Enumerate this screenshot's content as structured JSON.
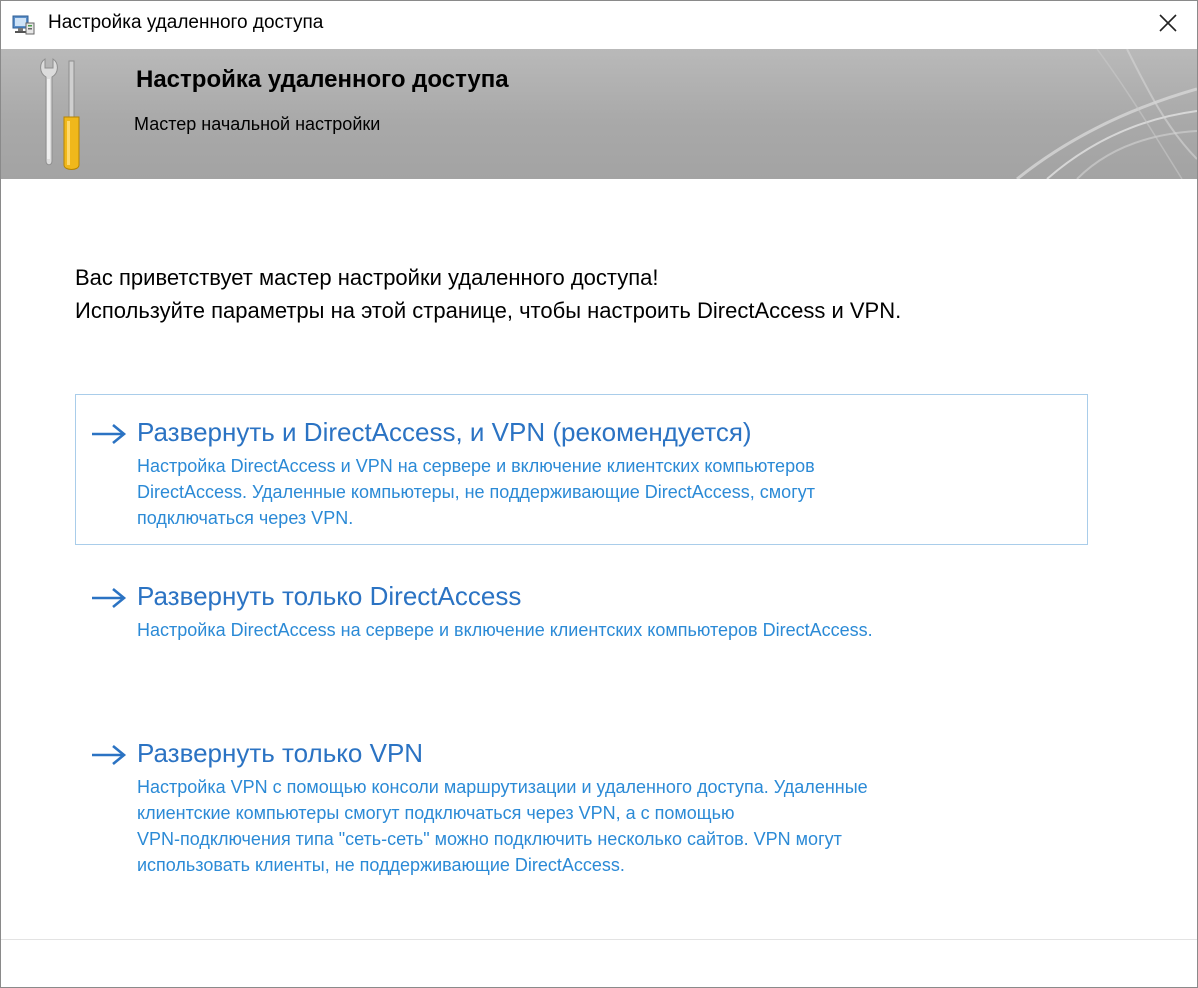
{
  "window": {
    "title": "Настройка удаленного доступа",
    "close_icon": "close-icon"
  },
  "banner": {
    "heading": "Настройка удаленного доступа",
    "subheading": "Мастер начальной настройки",
    "icon": "wrench-screwdriver-icon"
  },
  "intro": {
    "line1": "Вас приветствует мастер настройки удаленного доступа!",
    "line2": "Используйте параметры на этой странице, чтобы настроить DirectAccess и VPN."
  },
  "options": [
    {
      "label": "Развернуть и DirectAccess, и VPN (рекомендуется)",
      "desc": [
        "Настройка DirectAccess и VPN на сервере и включение клиентских компьютеров",
        "DirectAccess. Удаленные компьютеры, не поддерживающие DirectAccess, смогут",
        "подключаться через VPN."
      ],
      "selected": true
    },
    {
      "label": "Развернуть только DirectAccess",
      "desc": [
        "Настройка DirectAccess на сервере и включение клиентских компьютеров DirectAccess."
      ],
      "selected": false
    },
    {
      "label": "Развернуть только VPN",
      "desc": [
        "Настройка VPN с помощью консоли маршрутизации и удаленного доступа. Удаленные",
        "клиентские компьютеры смогут подключаться через VPN, а с помощью",
        "VPN-подключения типа \"сеть-сеть\" можно подключить несколько сайтов. VPN могут",
        "использовать клиенты, не поддерживающие DirectAccess."
      ],
      "selected": false
    }
  ],
  "colors": {
    "link": "#2b73c3",
    "link_desc": "#2b8ad6",
    "selected_border": "#a9cdea",
    "banner_bg": "#ababab"
  }
}
